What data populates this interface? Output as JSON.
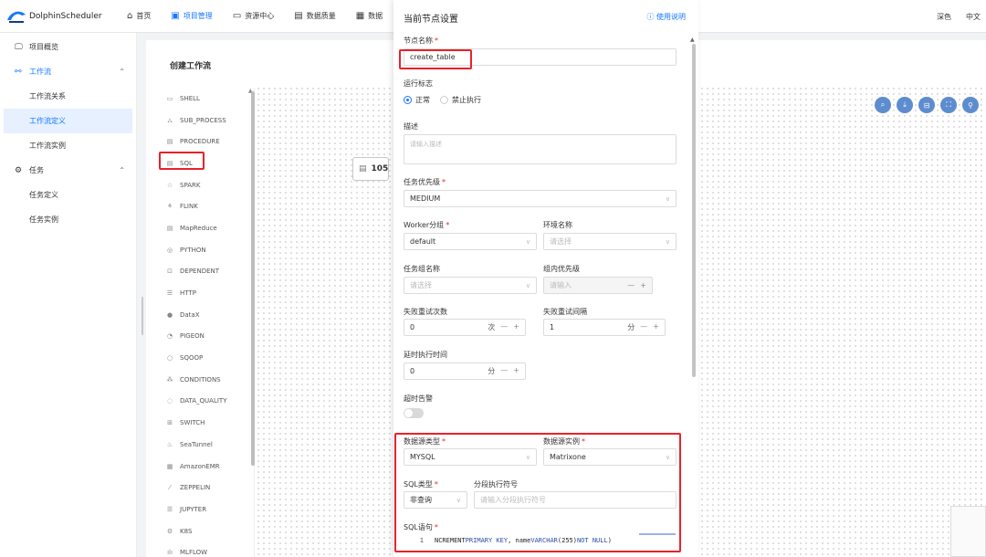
{
  "app": {
    "name": "DolphinScheduler"
  },
  "nav": {
    "items": [
      {
        "label": "首页",
        "icon": "home-icon"
      },
      {
        "label": "项目管理",
        "icon": "project-icon"
      },
      {
        "label": "资源中心",
        "icon": "folder-icon"
      },
      {
        "label": "数据质量",
        "icon": "data-quality-icon"
      },
      {
        "label": "数据",
        "icon": "datasource-icon"
      }
    ],
    "right": {
      "theme": "深色",
      "lang": "中文"
    }
  },
  "sidebar": {
    "items": [
      {
        "label": "项目概览",
        "icon": "overview-icon"
      },
      {
        "label": "工作流",
        "icon": "workflow-icon"
      },
      {
        "label": "工作流关系"
      },
      {
        "label": "工作流定义"
      },
      {
        "label": "工作流实例"
      },
      {
        "label": "任务",
        "icon": "gear-icon"
      },
      {
        "label": "任务定义"
      },
      {
        "label": "任务实例"
      }
    ]
  },
  "canvas": {
    "title": "创建工作流",
    "node_label": "105",
    "palette": [
      "SHELL",
      "SUB_PROCESS",
      "PROCEDURE",
      "SQL",
      "SPARK",
      "FLINK",
      "MapReduce",
      "PYTHON",
      "DEPENDENT",
      "HTTP",
      "DataX",
      "PIGEON",
      "SQOOP",
      "CONDITIONS",
      "DATA_QUALITY",
      "SWITCH",
      "SeaTunnel",
      "AmazonEMR",
      "ZEPPELIN",
      "JUPYTER",
      "K8S",
      "MLFLOW"
    ]
  },
  "drawer": {
    "title": "当前节点设置",
    "help": "使用说明",
    "node_name": {
      "label": "节点名称",
      "value": "create_table"
    },
    "run_flag": {
      "label": "运行标志",
      "options": [
        "正常",
        "禁止执行"
      ]
    },
    "description": {
      "label": "描述",
      "placeholder": "请输入描述"
    },
    "priority": {
      "label": "任务优先级",
      "value": "MEDIUM"
    },
    "worker_group": {
      "label": "Worker分组",
      "value": "default"
    },
    "env_name": {
      "label": "环境名称",
      "placeholder": "请选择"
    },
    "task_group": {
      "label": "任务组名称",
      "placeholder": "请选择"
    },
    "group_priority": {
      "label": "组内优先级",
      "placeholder": "请输入"
    },
    "retry_times": {
      "label": "失败重试次数",
      "value": "0",
      "unit": "次"
    },
    "retry_interval": {
      "label": "失败重试间隔",
      "value": "1",
      "unit": "分"
    },
    "delay_time": {
      "label": "延时执行时间",
      "value": "0",
      "unit": "分"
    },
    "timeout_alarm": {
      "label": "超时告警"
    },
    "datasource_type": {
      "label": "数据源类型",
      "value": "MYSQL"
    },
    "datasource_instance": {
      "label": "数据源实例",
      "value": "Matrixone"
    },
    "sql_type": {
      "label": "SQL类型",
      "value": "非查询"
    },
    "segment_separator": {
      "label": "分段执行符号",
      "placeholder": "请输入分段执行符号"
    },
    "sql_statement": {
      "label": "SQL语句",
      "line_number": "1",
      "code_a": "NCREMENT ",
      "code_b": "PRIMARY KEY",
      "code_c": ", name ",
      "code_d": "VARCHAR",
      "code_e": "(255) ",
      "code_f": "NOT NULL",
      "code_g": ")"
    }
  }
}
